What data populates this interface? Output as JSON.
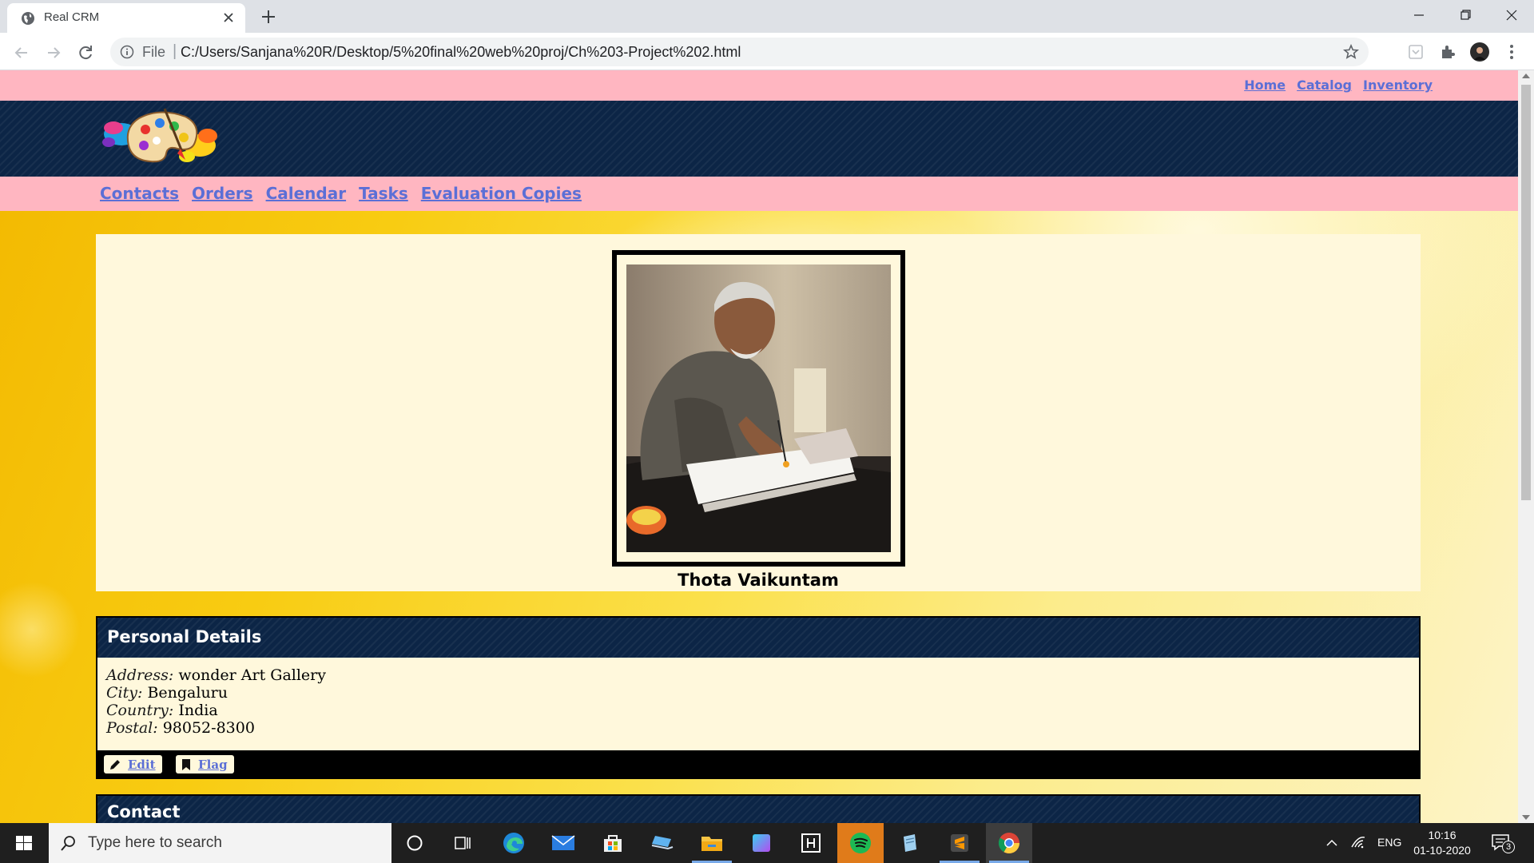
{
  "browser": {
    "tab_title": "Real CRM",
    "url_scheme": "File",
    "url": "C:/Users/Sanjana%20R/Desktop/5%20final%20web%20proj/Ch%203-Project%202.html"
  },
  "top_links": [
    "Home",
    "Catalog",
    "Inventory"
  ],
  "nav_links": [
    "Contacts",
    "Orders",
    "Calendar",
    "Tasks",
    "Evaluation Copies"
  ],
  "profile": {
    "name": "Thota Vaikuntam"
  },
  "personal_details": {
    "title": "Personal Details",
    "fields": [
      {
        "label": "Address:",
        "value": "wonder Art Gallery"
      },
      {
        "label": "City:",
        "value": "Bengaluru"
      },
      {
        "label": "Country:",
        "value": "India"
      },
      {
        "label": "Postal:",
        "value": "98052-8300"
      }
    ],
    "edit_label": "Edit",
    "flag_label": "Flag"
  },
  "contact_section": {
    "title": "Contact"
  },
  "taskbar": {
    "search_placeholder": "Type here to search",
    "language": "ENG",
    "time": "10:16",
    "date": "01-10-2020",
    "notification_count": "3",
    "apps": [
      "task-view-icon",
      "edge-icon",
      "mail-icon",
      "store-icon",
      "laptop-icon",
      "file-explorer-icon",
      "app-square-icon",
      "terminal-icon",
      "spotify-icon",
      "notepad-icon",
      "sublime-icon",
      "chrome-icon"
    ]
  },
  "colors": {
    "pink_bar": "#ffb6c1",
    "navy_header": "#0c2546",
    "card_bg": "#fff8dc",
    "link": "#5b6fd6"
  }
}
